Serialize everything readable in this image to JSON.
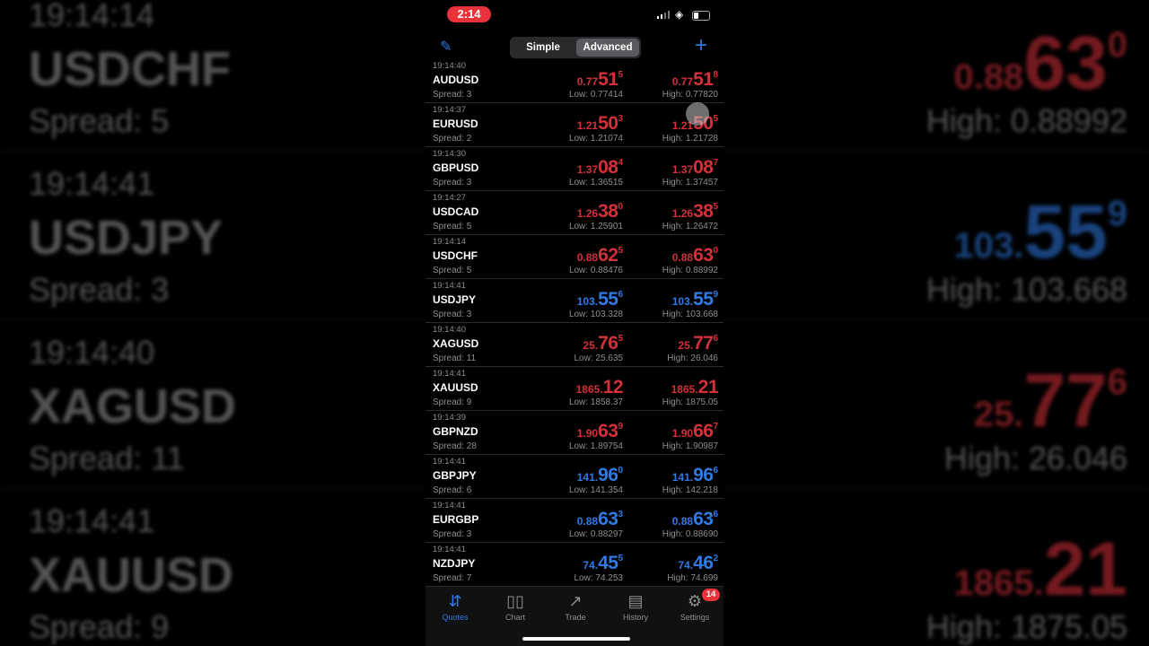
{
  "status": {
    "time": "2:14"
  },
  "toolbar": {
    "modes": [
      "Simple",
      "Advanced"
    ],
    "active_mode": "Advanced"
  },
  "quotes": [
    {
      "time": "19:14:40",
      "symbol": "AUDUSD",
      "spread": "Spread: 3",
      "color": "red",
      "bid": {
        "a": "0.77",
        "b": "51",
        "c": "5"
      },
      "ask": {
        "a": "0.77",
        "b": "51",
        "c": "8"
      },
      "low": "Low: 0.77414",
      "high": "High: 0.77820"
    },
    {
      "time": "19:14:37",
      "symbol": "EURUSD",
      "spread": "Spread: 2",
      "color": "red",
      "bid": {
        "a": "1.21",
        "b": "50",
        "c": "3"
      },
      "ask": {
        "a": "1.21",
        "b": "50",
        "c": "5"
      },
      "low": "Low: 1.21074",
      "high": "High: 1.21728"
    },
    {
      "time": "19:14:30",
      "symbol": "GBPUSD",
      "spread": "Spread: 3",
      "color": "red",
      "bid": {
        "a": "1.37",
        "b": "08",
        "c": "4"
      },
      "ask": {
        "a": "1.37",
        "b": "08",
        "c": "7"
      },
      "low": "Low: 1.36515",
      "high": "High: 1.37457"
    },
    {
      "time": "19:14:27",
      "symbol": "USDCAD",
      "spread": "Spread: 5",
      "color": "red",
      "bid": {
        "a": "1.26",
        "b": "38",
        "c": "0"
      },
      "ask": {
        "a": "1.26",
        "b": "38",
        "c": "5"
      },
      "low": "Low: 1.25901",
      "high": "High: 1.26472"
    },
    {
      "time": "19:14:14",
      "symbol": "USDCHF",
      "spread": "Spread: 5",
      "color": "red",
      "bid": {
        "a": "0.88",
        "b": "62",
        "c": "5"
      },
      "ask": {
        "a": "0.88",
        "b": "63",
        "c": "0"
      },
      "low": "Low: 0.88476",
      "high": "High: 0.88992"
    },
    {
      "time": "19:14:41",
      "symbol": "USDJPY",
      "spread": "Spread: 3",
      "color": "blue",
      "bid": {
        "a": "103.",
        "b": "55",
        "c": "6"
      },
      "ask": {
        "a": "103.",
        "b": "55",
        "c": "9"
      },
      "low": "Low: 103.328",
      "high": "High: 103.668"
    },
    {
      "time": "19:14:40",
      "symbol": "XAGUSD",
      "spread": "Spread: 11",
      "color": "red",
      "bid": {
        "a": "25.",
        "b": "76",
        "c": "5"
      },
      "ask": {
        "a": "25.",
        "b": "77",
        "c": "6"
      },
      "low": "Low: 25.635",
      "high": "High: 26.046"
    },
    {
      "time": "19:14:41",
      "symbol": "XAUUSD",
      "spread": "Spread: 9",
      "color": "red",
      "bid": {
        "a": "1865.",
        "b": "12",
        "c": ""
      },
      "ask": {
        "a": "1865.",
        "b": "21",
        "c": ""
      },
      "low": "Low: 1858.37",
      "high": "High: 1875.05"
    },
    {
      "time": "19:14:39",
      "symbol": "GBPNZD",
      "spread": "Spread: 28",
      "color": "red",
      "bid": {
        "a": "1.90",
        "b": "63",
        "c": "9"
      },
      "ask": {
        "a": "1.90",
        "b": "66",
        "c": "7"
      },
      "low": "Low: 1.89754",
      "high": "High: 1.90987"
    },
    {
      "time": "19:14:41",
      "symbol": "GBPJPY",
      "spread": "Spread: 6",
      "color": "blue",
      "bid": {
        "a": "141.",
        "b": "96",
        "c": "0"
      },
      "ask": {
        "a": "141.",
        "b": "96",
        "c": "6"
      },
      "low": "Low: 141.354",
      "high": "High: 142.218"
    },
    {
      "time": "19:14:41",
      "symbol": "EURGBP",
      "spread": "Spread: 3",
      "color": "blue",
      "bid": {
        "a": "0.88",
        "b": "63",
        "c": "3"
      },
      "ask": {
        "a": "0.88",
        "b": "63",
        "c": "6"
      },
      "low": "Low: 0.88297",
      "high": "High: 0.88690"
    },
    {
      "time": "19:14:41",
      "symbol": "NZDJPY",
      "spread": "Spread: 7",
      "color": "blue",
      "bid": {
        "a": "74.",
        "b": "45",
        "c": "5"
      },
      "ask": {
        "a": "74.",
        "b": "46",
        "c": "2"
      },
      "low": "Low: 74.253",
      "high": "High: 74.699"
    }
  ],
  "tabs": [
    {
      "label": "Quotes",
      "icon": "quotes-icon"
    },
    {
      "label": "Chart",
      "icon": "chart-icon"
    },
    {
      "label": "Trade",
      "icon": "trade-icon"
    },
    {
      "label": "History",
      "icon": "history-icon"
    },
    {
      "label": "Settings",
      "icon": "settings-icon"
    }
  ],
  "active_tab": "Quotes",
  "settings_badge": "14",
  "colors": {
    "sell_red": "#d3303a",
    "buy_blue": "#2f7ae5",
    "accent": "#2f7ae5"
  },
  "backdrop": {
    "left": [
      {
        "time": "19:14:14",
        "symbol": "USDCHF",
        "spread": "Spread: 5"
      },
      {
        "time": "19:14:41",
        "symbol": "USDJPY",
        "spread": "Spread: 3"
      },
      {
        "time": "19:14:40",
        "symbol": "XAGUSD",
        "spread": "Spread: 11"
      },
      {
        "time": "19:14:41",
        "symbol": "XAUUSD",
        "spread": "Spread: 9"
      }
    ],
    "right": [
      {
        "color": "red",
        "a": "0.88",
        "b": "63",
        "c": "0",
        "high": "High: 0.88992"
      },
      {
        "color": "blue",
        "a": "103.",
        "b": "55",
        "c": "9",
        "high": "High: 103.668"
      },
      {
        "color": "red",
        "a": "25.",
        "b": "77",
        "c": "6",
        "high": "High: 26.046"
      },
      {
        "color": "red",
        "a": "1865.",
        "b": "21",
        "c": "",
        "high": "High: 1875.05"
      }
    ]
  }
}
